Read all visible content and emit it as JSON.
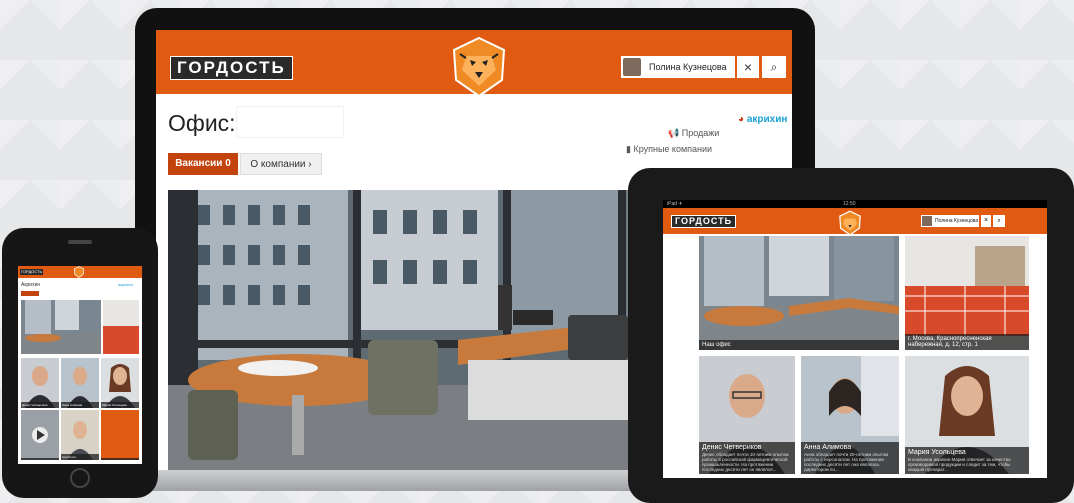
{
  "laptop": {
    "logo": "ГОРДОСТЬ",
    "user_name": "Полина Кузнецова",
    "close_icon": "×",
    "search_icon": "⌕",
    "page_title": "Офис:",
    "partner_logo": "акрихин",
    "meta_sales": "Продажи",
    "meta_companies": "Крупные компании",
    "tab_vacancies_label": "Вакансии",
    "tab_vacancies_count": "0",
    "tab_about": "О компании ›",
    "brand_color": "#e15a12"
  },
  "tablet": {
    "status_left": "iPad ✈",
    "status_time": "12:50",
    "logo": "ГОРДОСТЬ",
    "user_name": "Полина Кузнецова",
    "close_icon": "×",
    "search_icon": "⌕",
    "tiles": [
      {
        "caption": "Наш офис"
      },
      {
        "caption": "г. Москва, Краснопресненская набережная, д. 12, стр. 1"
      },
      {
        "name": "Денис Четвериков",
        "desc": "Денис обладает почти 10-летним опытом работы в российской фармацевтической промышленности. На протяжении последних десяти лет он являлся..."
      },
      {
        "name": "Анна Алимова",
        "desc": "Анна обладает почти 20-летним опытом работы с персоналом. На протяжении последних десяти лет она являлась директором по..."
      },
      {
        "name": "Мария Усольцева",
        "desc": "В компании акрихин Мария отвечает за качество производимой продукции и следит за тем, чтобы каждый препарат..."
      }
    ]
  },
  "phone": {
    "logo": "ГОРДОСТЬ",
    "page_title": "Акрихин",
    "partner_logo": "акрихин",
    "tiles": [
      {
        "caption": "Денис Четвериков"
      },
      {
        "caption": "Анна Алимова"
      },
      {
        "caption": "Мария Усольцева"
      },
      {
        "caption": ""
      },
      {
        "caption": "Ассистент"
      },
      {
        "caption": ""
      }
    ]
  }
}
